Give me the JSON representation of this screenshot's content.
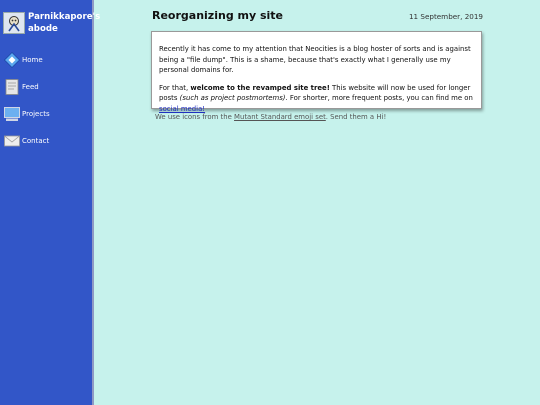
{
  "site": {
    "name_line1": "Parnikkapore's",
    "name_line2": "abode"
  },
  "nav": {
    "items": [
      {
        "label": "Home",
        "icon": "home-diamond-icon"
      },
      {
        "label": "Feed",
        "icon": "document-icon"
      },
      {
        "label": "Projects",
        "icon": "computer-icon"
      },
      {
        "label": "Contact",
        "icon": "envelope-icon"
      }
    ]
  },
  "post": {
    "title": "Reorganizing my site",
    "date": "11 September, 2019",
    "p1": "Recently it has come to my attention that Neocities is a blog hoster of sorts and is against being a \"file dump\". This is a shame, because that's exactly what I generally use my personal domains for.",
    "p2_lead": "For that, ",
    "p2_bold": "welcome to the revamped site tree!",
    "p2_mid": " This website will now be used for longer posts ",
    "p2_italic": "(such as project postmortems)",
    "p2_tail": ". For shorter, more frequent posts, you can find me on ",
    "p2_link": "social media!"
  },
  "footer": {
    "lead": "We use icons from the ",
    "link": "Mutant Standard emoji set",
    "tail": ". Send them a Hi!"
  },
  "colors": {
    "sidebar": "#3256c8",
    "background": "#c6f2ec",
    "link": "#2030c0"
  }
}
